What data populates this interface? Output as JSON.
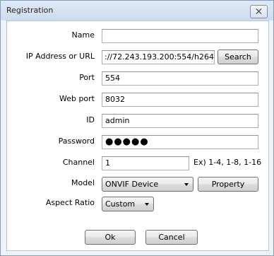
{
  "window": {
    "title": "Registration"
  },
  "form": {
    "name": {
      "label": "Name",
      "value": ""
    },
    "ip": {
      "label": "IP Address or URL",
      "value": "://72.243.193.200:554/h264",
      "button": "Search"
    },
    "port": {
      "label": "Port",
      "value": "554"
    },
    "web_port": {
      "label": "Web port",
      "value": "8032"
    },
    "id": {
      "label": "ID",
      "value": "admin"
    },
    "password": {
      "label": "Password",
      "value": "●●●●●"
    },
    "channel": {
      "label": "Channel",
      "value": "1",
      "hint": "Ex) 1-4, 1-8, 1-16"
    },
    "model": {
      "label": "Model",
      "selected": "ONVIF Device",
      "button": "Property"
    },
    "aspect": {
      "label": "Aspect Ratio",
      "selected": "Custom"
    }
  },
  "footer": {
    "ok": "Ok",
    "cancel": "Cancel"
  },
  "icons": {
    "close": "close-icon",
    "dropdown": "chevron-down-icon"
  }
}
